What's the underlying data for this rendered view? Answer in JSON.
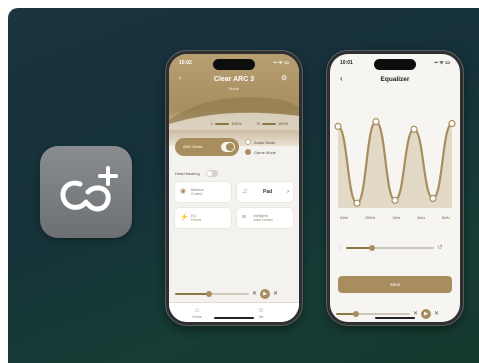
{
  "app_icon": {
    "icon": "link-plus-icon",
    "bg": "#7c7f82"
  },
  "phone1": {
    "status_time": "10:02",
    "status_right": "▪▪ ᯤ ▭",
    "title": "Clear ARC 3",
    "subtitle": "Mode",
    "battery_left": "L",
    "battery_left_pct": "100%",
    "battery_right": "R",
    "battery_right_pct": "100%",
    "anc_label": "ANC Mode",
    "opt_audio": "Audio Mode",
    "opt_game": "Game Mode",
    "head_tracking": "Head tracking",
    "tiles": [
      {
        "icon": "speaker-icon",
        "text1": "Balance",
        "text2": "Control"
      },
      {
        "icon": "headphone-icon",
        "text1": "Pad",
        "text2": ""
      },
      {
        "icon": "sliders-icon",
        "text1": "EQ",
        "text2": "Preset"
      },
      {
        "icon": "bars-icon",
        "text1": "Intelligent",
        "text2": "voice control"
      }
    ],
    "tab_home": "Home",
    "tab_me": "Me",
    "accent": "#a88e5f"
  },
  "phone2": {
    "status_time": "10:01",
    "status_right": "▪▪ ᯤ ▭",
    "title": "Equalizer",
    "freqs": [
      "64Hz",
      "250Hz",
      "1kHz",
      "4kHz",
      "8kHz"
    ],
    "save_label": "Save",
    "gain_levels": [
      0.85,
      0.05,
      0.9,
      0.08,
      0.82,
      0.1,
      0.88
    ]
  }
}
